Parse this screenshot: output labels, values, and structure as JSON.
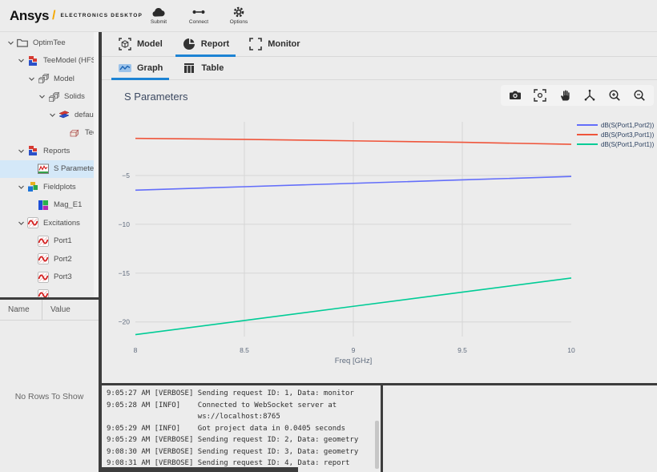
{
  "header": {
    "brand": {
      "name": "Ansys",
      "slash": "/",
      "product": "ELECTRONICS DESKTOP"
    },
    "actions": [
      {
        "label": "Submit",
        "icon": "cloud-upload-icon"
      },
      {
        "label": "Connect",
        "icon": "connect-icon"
      },
      {
        "label": "Options",
        "icon": "gear-icon"
      }
    ]
  },
  "sidebar": {
    "tree": [
      {
        "label": "OptimTee",
        "level": 0,
        "icon": "folder-icon",
        "expanded": true
      },
      {
        "label": "TeeModel (HFSS)",
        "level": 1,
        "icon": "hfss-model-icon",
        "expanded": true
      },
      {
        "label": "Model",
        "level": 2,
        "icon": "solids-group-icon",
        "expanded": true
      },
      {
        "label": "Solids",
        "level": 3,
        "icon": "solids-group-icon",
        "expanded": true
      },
      {
        "label": "default",
        "level": 4,
        "icon": "material-layers-icon",
        "expanded": true
      },
      {
        "label": "Tee",
        "level": 5,
        "icon": "solid-box-icon",
        "leaf": true
      },
      {
        "label": "Reports",
        "level": 1,
        "icon": "reports-icon",
        "expanded": true
      },
      {
        "label": "S Parameters",
        "level": 2,
        "icon": "report-chart-icon",
        "leaf": true,
        "selected": true
      },
      {
        "label": "Fieldplots",
        "level": 1,
        "icon": "fieldplots-icon",
        "expanded": true
      },
      {
        "label": "Mag_E1",
        "level": 2,
        "icon": "fieldplot-icon",
        "leaf": true
      },
      {
        "label": "Excitations",
        "level": 1,
        "icon": "excitation-icon",
        "expanded": true
      },
      {
        "label": "Port1",
        "level": 2,
        "icon": "excitation-icon",
        "leaf": true
      },
      {
        "label": "Port2",
        "level": 2,
        "icon": "excitation-icon",
        "leaf": true
      },
      {
        "label": "Port3",
        "level": 2,
        "icon": "excitation-icon",
        "leaf": true
      },
      {
        "label": "",
        "level": 2,
        "icon": "excitation-icon",
        "leaf": true,
        "partial": true
      }
    ],
    "properties": {
      "columns": [
        "Name",
        "Value"
      ],
      "empty_text": "No Rows To Show"
    }
  },
  "main": {
    "tabs": [
      {
        "label": "Model",
        "icon": "model-icon",
        "active": false
      },
      {
        "label": "Report",
        "icon": "report-pie-icon",
        "active": true
      },
      {
        "label": "Monitor",
        "icon": "monitor-icon",
        "active": false
      }
    ],
    "subtabs": [
      {
        "label": "Graph",
        "icon": "graph-icon",
        "active": true
      },
      {
        "label": "Table",
        "icon": "table-icon",
        "active": false
      }
    ],
    "toolbar": [
      "camera-icon",
      "scan-icon",
      "pan-icon",
      "axes-icon",
      "zoom-in-icon",
      "zoom-out-icon"
    ]
  },
  "chart_data": {
    "type": "line",
    "title": "S Parameters",
    "xlabel": "Freq [GHz]",
    "ylabel": "",
    "xlim": [
      8,
      10
    ],
    "ylim": [
      -21.5,
      0.5
    ],
    "xticks": [
      8,
      8.5,
      9,
      9.5,
      10
    ],
    "yticks": [
      -5,
      -10,
      -15,
      -20
    ],
    "grid": true,
    "legend_position": "top-right",
    "series": [
      {
        "name": "dB(S(Port1,Port2))",
        "color": "#636EFA",
        "x": [
          8,
          8.5,
          9,
          9.5,
          10
        ],
        "y": [
          -6.5,
          -6.15,
          -5.8,
          -5.45,
          -5.1
        ]
      },
      {
        "name": "dB(S(Port3,Port1))",
        "color": "#EF553B",
        "x": [
          8,
          8.5,
          9,
          9.5,
          10
        ],
        "y": [
          -1.2,
          -1.3,
          -1.45,
          -1.6,
          -1.8
        ]
      },
      {
        "name": "dB(S(Port1,Port1))",
        "color": "#00CC96",
        "x": [
          8,
          8.5,
          9,
          9.5,
          10
        ],
        "y": [
          -21.3,
          -19.85,
          -18.4,
          -16.95,
          -15.5
        ]
      }
    ]
  },
  "console": {
    "entries": [
      {
        "time": "9:05:27 AM",
        "level": "VERBOSE",
        "text": "Sending request ID: 1, Data: monitor"
      },
      {
        "time": "9:05:28 AM",
        "level": "INFO",
        "text": "Connected to WebSocket server at"
      },
      {
        "time": "",
        "level": "",
        "text": "ws://localhost:8765",
        "continuation": true
      },
      {
        "time": "9:05:29 AM",
        "level": "INFO",
        "text": "Got project data in 0.0405 seconds"
      },
      {
        "time": "9:05:29 AM",
        "level": "VERBOSE",
        "text": "Sending request ID: 2, Data: geometry"
      },
      {
        "time": "9:08:30 AM",
        "level": "VERBOSE",
        "text": "Sending request ID: 3, Data: geometry"
      },
      {
        "time": "9:08:31 AM",
        "level": "VERBOSE",
        "text": "Sending request ID: 4, Data: report"
      }
    ]
  }
}
